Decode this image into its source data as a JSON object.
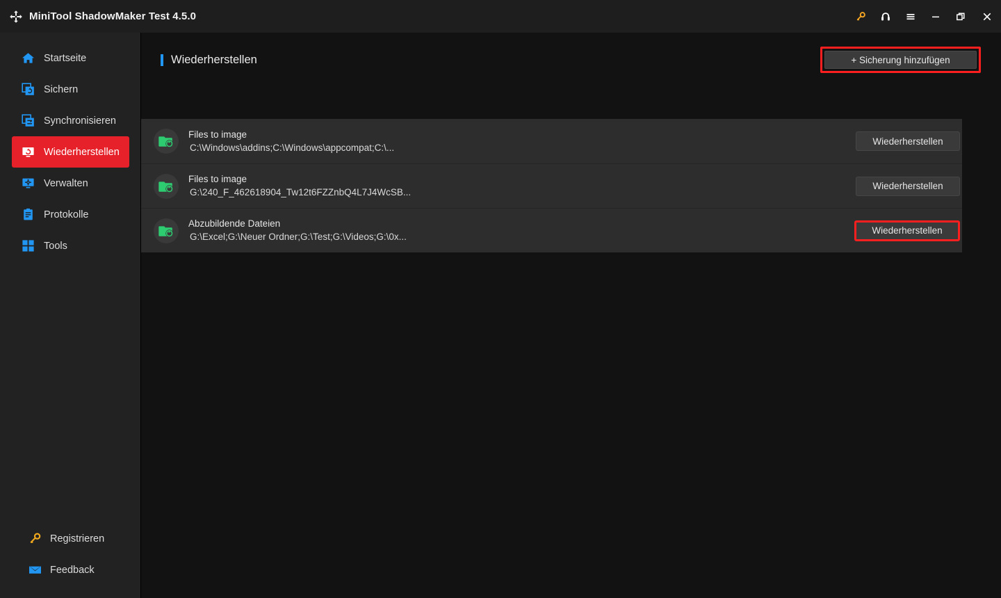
{
  "window": {
    "title": "MiniTool ShadowMaker Test 4.5.0",
    "logo_icon": "shadowmaker-logo-icon",
    "controls": [
      {
        "name": "key-icon",
        "label": "",
        "color": "#f5a623"
      },
      {
        "name": "headset-icon",
        "label": "",
        "color": "#ffffff"
      },
      {
        "name": "menu-icon",
        "label": "",
        "color": "#ffffff"
      },
      {
        "name": "minimize-icon",
        "label": "",
        "color": "#ffffff"
      },
      {
        "name": "maximize-icon",
        "label": "",
        "color": "#ffffff"
      },
      {
        "name": "close-icon",
        "label": "",
        "color": "#ffffff"
      }
    ]
  },
  "sidebar": {
    "items": [
      {
        "label": "Startseite",
        "icon": "home-icon",
        "active": false
      },
      {
        "label": "Sichern",
        "icon": "backup-icon",
        "active": false
      },
      {
        "label": "Synchronisieren",
        "icon": "sync-icon",
        "active": false
      },
      {
        "label": "Wiederherstellen",
        "icon": "restore-icon",
        "active": true
      },
      {
        "label": "Verwalten",
        "icon": "manage-icon",
        "active": false
      },
      {
        "label": "Protokolle",
        "icon": "logs-icon",
        "active": false
      },
      {
        "label": "Tools",
        "icon": "tools-icon",
        "active": false
      }
    ],
    "bottom_items": [
      {
        "label": "Registrieren",
        "icon": "key-icon"
      },
      {
        "label": "Feedback",
        "icon": "envelope-icon"
      }
    ],
    "active_color": "#e62129"
  },
  "main": {
    "page_title": "Wiederherstellen",
    "accent_color": "#2196f3",
    "add_backup_label": "+ Sicherung hinzufügen",
    "add_backup_highlighted": true,
    "highlight_color": "#fb1f1f",
    "backups": [
      {
        "title": "Files to image",
        "path": "C:\\Windows\\addins;C:\\Windows\\appcompat;C:\\...",
        "icon": "folder-restore-icon",
        "action_label": "Wiederherstellen",
        "highlighted": false
      },
      {
        "title": "Files to image",
        "path": "G:\\240_F_462618904_Tw12t6FZZnbQ4L7J4WcSB...",
        "icon": "folder-restore-icon",
        "action_label": "Wiederherstellen",
        "highlighted": false
      },
      {
        "title": "Abzubildende Dateien",
        "path": "G:\\Excel;G:\\Neuer Ordner;G:\\Test;G:\\Videos;G:\\0x...",
        "icon": "folder-restore-icon",
        "action_label": "Wiederherstellen",
        "highlighted": true
      }
    ]
  }
}
